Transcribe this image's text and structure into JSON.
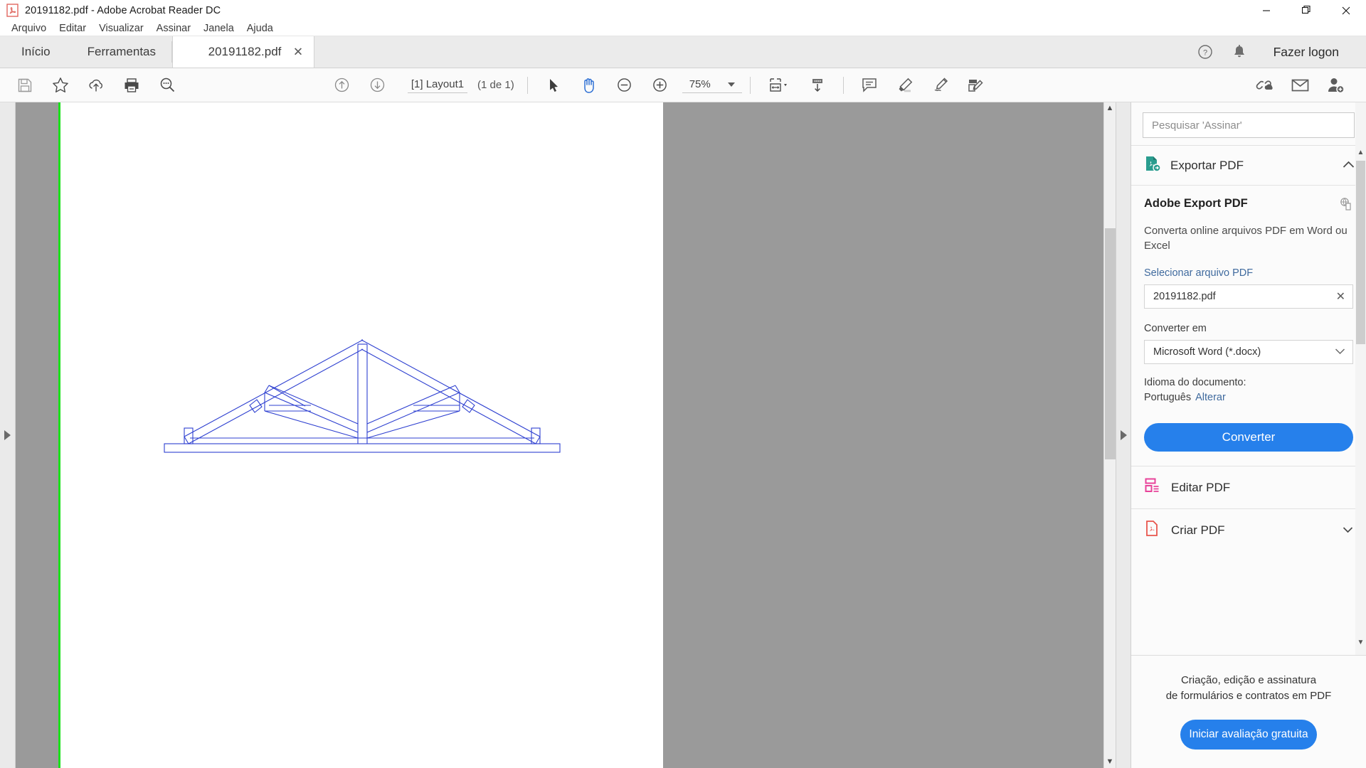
{
  "window": {
    "title": "20191182.pdf - Adobe Acrobat Reader DC",
    "minimize": "–",
    "restore": "❐",
    "close": "✕"
  },
  "menu": {
    "items": [
      "Arquivo",
      "Editar",
      "Visualizar",
      "Assinar",
      "Janela",
      "Ajuda"
    ]
  },
  "tabs": {
    "home": "Início",
    "tools": "Ferramentas",
    "document": "20191182.pdf",
    "close": "✕",
    "help_icon": "help-circle-icon",
    "bell_icon": "notification-bell-icon",
    "logon": "Fazer logon"
  },
  "toolbar": {
    "save_icon": "save-icon",
    "star_icon": "star-icon",
    "cloud_icon": "cloud-upload-icon",
    "print_icon": "print-icon",
    "search_icon": "search-icon",
    "prev_page_icon": "previous-page-icon",
    "next_page_icon": "next-page-icon",
    "page_label": "[1] Layout1",
    "page_count": "(1 de 1)",
    "select_icon": "select-cursor-icon",
    "hand_icon": "hand-tool-icon",
    "zoom_out_icon": "zoom-out-icon",
    "zoom_in_icon": "zoom-in-icon",
    "zoom_value": "75%",
    "fit_page_icon": "fit-page-icon",
    "scroll_mode_icon": "scroll-mode-icon",
    "comment_icon": "comment-icon",
    "highlight_icon": "highlight-icon",
    "sign_icon": "sign-icon",
    "fill_sign_icon": "fill-and-sign-icon",
    "share_link_icon": "share-link-icon",
    "email_icon": "email-icon",
    "add_person_icon": "add-person-icon"
  },
  "document": {
    "drawing": "roof-truss-technical-drawing",
    "line_color": "#2d3fd0",
    "page_background": "#ffffff",
    "surround_color": "#9a9a9a",
    "edge_highlight": "#19e219"
  },
  "panel": {
    "search_placeholder": "Pesquisar 'Assinar'",
    "export_section": {
      "icon": "export-pdf-icon",
      "title": "Exportar PDF",
      "collapse_chevron": "⌃",
      "heading": "Adobe Export PDF",
      "copy_icon": "copy-document-icon",
      "description": "Converta online arquivos PDF em Word ou Excel",
      "select_file_label": "Selecionar arquivo PDF",
      "selected_file": "20191182.pdf",
      "clear_icon": "✕",
      "convert_to_label": "Converter em",
      "convert_to_value": "Microsoft Word (*.docx)",
      "dropdown_chevron": "⌄",
      "language_label": "Idioma do documento:",
      "language_value": "Português",
      "language_change": "Alterar",
      "convert_button": "Converter",
      "accent_color": "#2680eb"
    },
    "tools": [
      {
        "icon": "edit-pdf-icon",
        "label": "Editar PDF",
        "color": "#e8439a"
      },
      {
        "icon": "create-pdf-icon",
        "label": "Criar PDF",
        "color": "#e8554d"
      }
    ],
    "promo": {
      "line1": "Criação, edição e assinatura",
      "line2": "de formulários e contratos em PDF",
      "button": "Iniciar avaliação gratuita"
    }
  }
}
